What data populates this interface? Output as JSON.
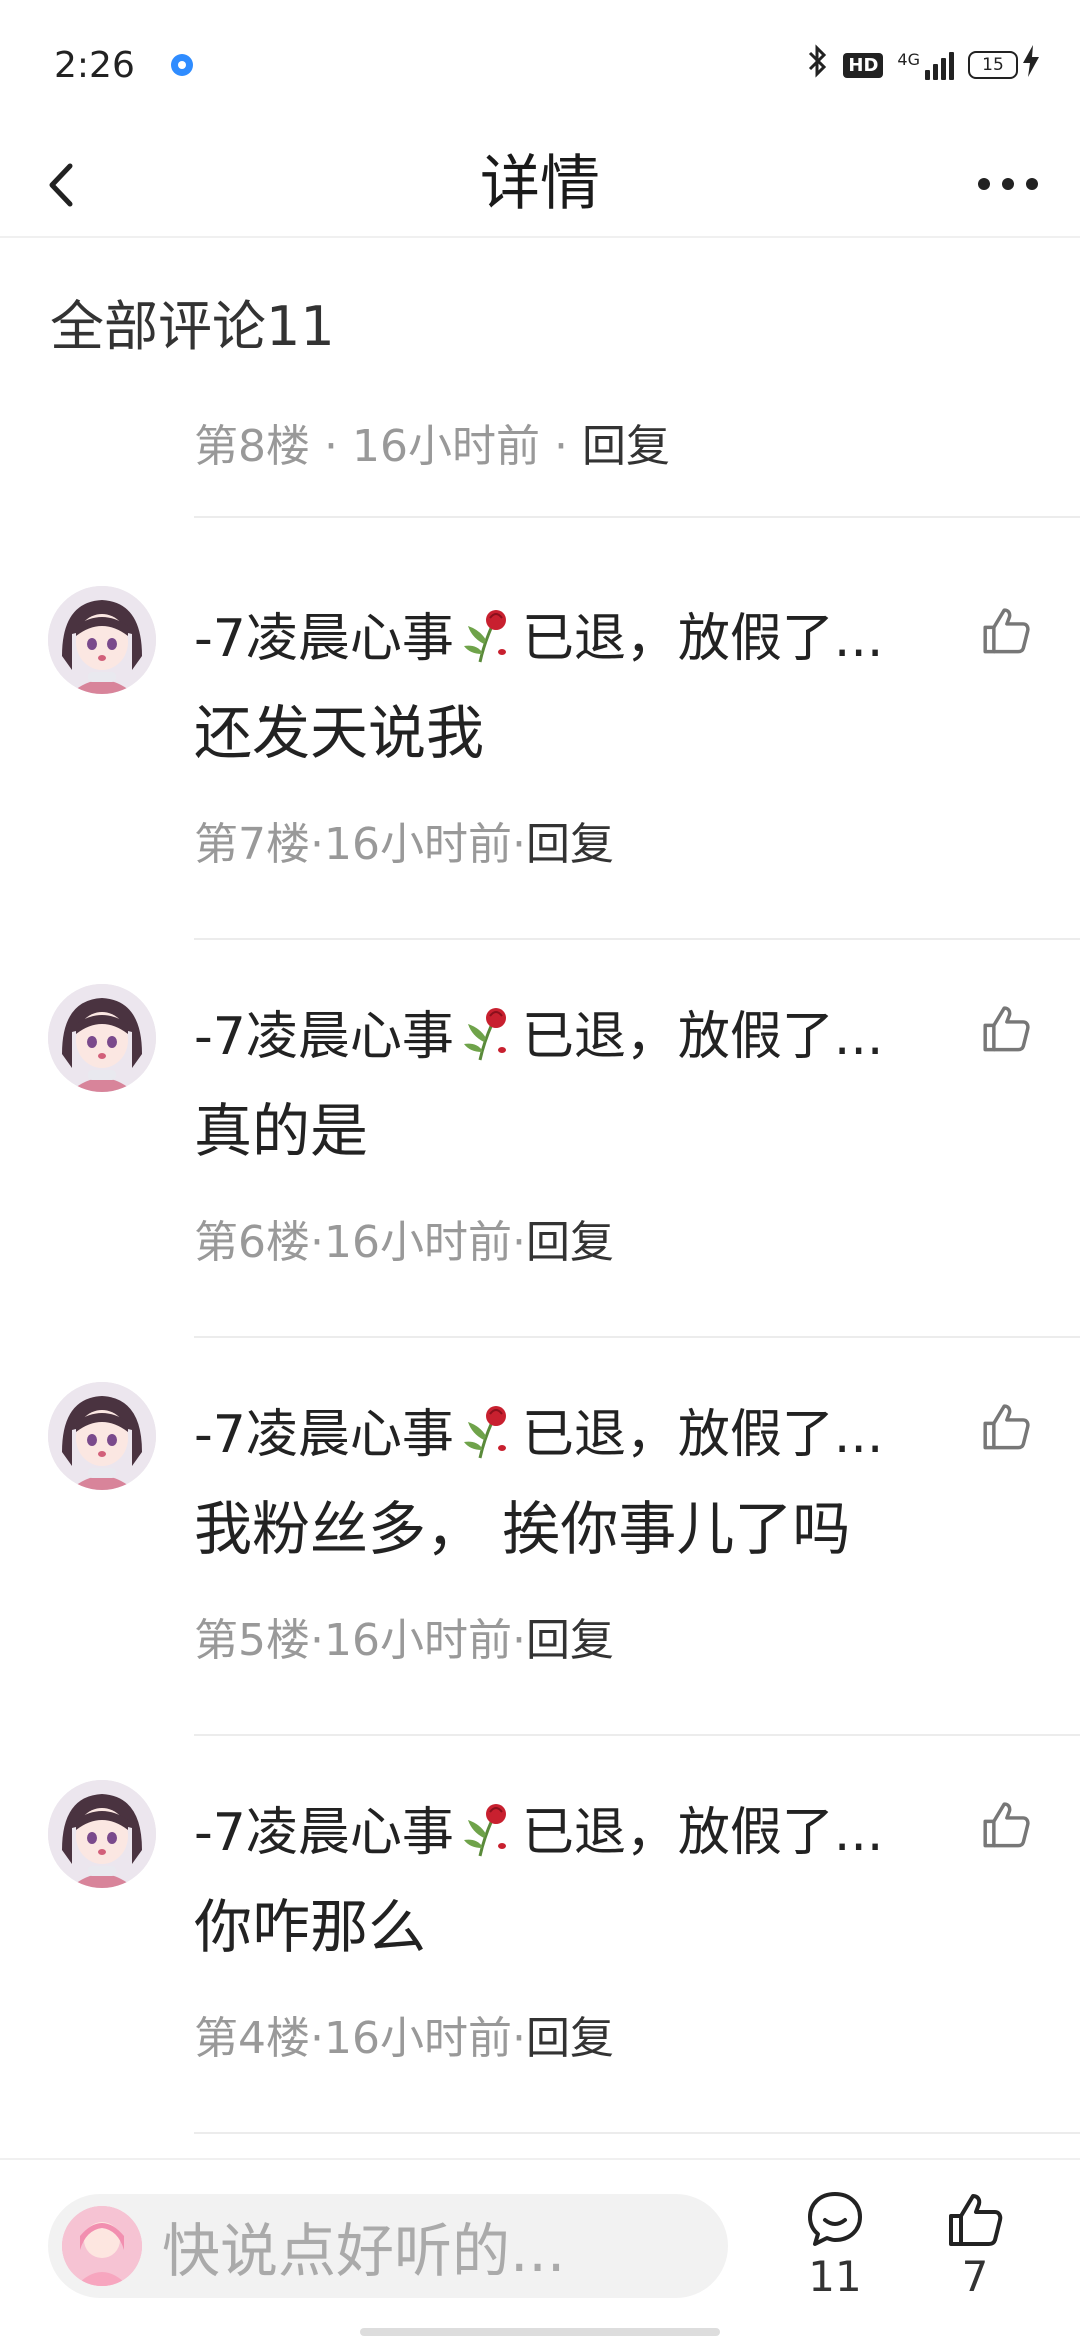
{
  "status_bar": {
    "time": "2:26",
    "network_label": "4G",
    "hd_label": "HD",
    "battery": "15"
  },
  "header": {
    "title": "详情"
  },
  "section": {
    "title": "全部评论11"
  },
  "top_partial": {
    "floor": "第8楼",
    "time": "16小时前",
    "reply": "回复"
  },
  "comments": [
    {
      "name_prefix": "-7凌晨心事",
      "name_suffix": "已退，放假了...",
      "text": "还发天说我",
      "floor": "第7楼",
      "time": "16小时前",
      "reply": "回复"
    },
    {
      "name_prefix": "-7凌晨心事",
      "name_suffix": "已退，放假了...",
      "text": "真的是",
      "floor": "第6楼",
      "time": "16小时前",
      "reply": "回复"
    },
    {
      "name_prefix": "-7凌晨心事",
      "name_suffix": "已退，放假了...",
      "text": "我粉丝多， 挨你事儿了吗",
      "floor": "第5楼",
      "time": "16小时前",
      "reply": "回复"
    },
    {
      "name_prefix": "-7凌晨心事",
      "name_suffix": "已退，放假了...",
      "text": "你咋那么",
      "floor": "第4楼",
      "time": "16小时前",
      "reply": "回复"
    }
  ],
  "separator": "·",
  "bottom_bar": {
    "input_placeholder": "快说点好听的...",
    "comment_count": "11",
    "like_count": "7"
  },
  "colors": {
    "accent_dot": "#2f8cff",
    "meta_gray": "#999999",
    "text": "#222222"
  }
}
